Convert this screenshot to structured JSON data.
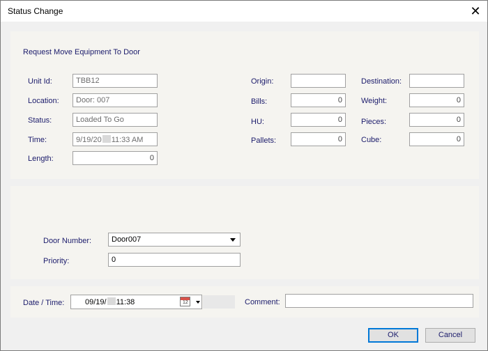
{
  "window": {
    "title": "Status Change"
  },
  "header": {
    "subtitle": "Request Move Equipment To Door"
  },
  "left_fields": {
    "unit_id": {
      "label": "Unit Id:",
      "value": "TBB12"
    },
    "location": {
      "label": "Location:",
      "value": "Door: 007"
    },
    "status": {
      "label": "Status:",
      "value": "Loaded To Go"
    },
    "time": {
      "label": "Time:",
      "value_prefix": "9/19/20",
      "value_suffix": "11:33 AM"
    },
    "length": {
      "label": "Length:",
      "value": "0"
    }
  },
  "mid_fields": {
    "origin": {
      "label": "Origin:",
      "value": ""
    },
    "bills": {
      "label": "Bills:",
      "value": "0"
    },
    "hu": {
      "label": "HU:",
      "value": "0"
    },
    "pallets": {
      "label": "Pallets:",
      "value": "0"
    }
  },
  "right_fields": {
    "destination": {
      "label": "Destination:",
      "value": ""
    },
    "weight": {
      "label": "Weight:",
      "value": "0"
    },
    "pieces": {
      "label": "Pieces:",
      "value": "0"
    },
    "cube": {
      "label": "Cube:",
      "value": "0"
    }
  },
  "door": {
    "door_number": {
      "label": "Door Number:",
      "value": "Door007"
    },
    "priority": {
      "label": "Priority:",
      "value": "0"
    }
  },
  "bottom": {
    "datetime": {
      "label": "Date / Time:",
      "value_prefix": "09/19/",
      "value_suffix": "11:38"
    },
    "comment": {
      "label": "Comment:",
      "value": ""
    }
  },
  "buttons": {
    "ok": "OK",
    "cancel": "Cancel"
  },
  "icons": {
    "close": "close-icon",
    "calendar": "calendar-icon",
    "dropdown": "chevron-down-icon"
  }
}
